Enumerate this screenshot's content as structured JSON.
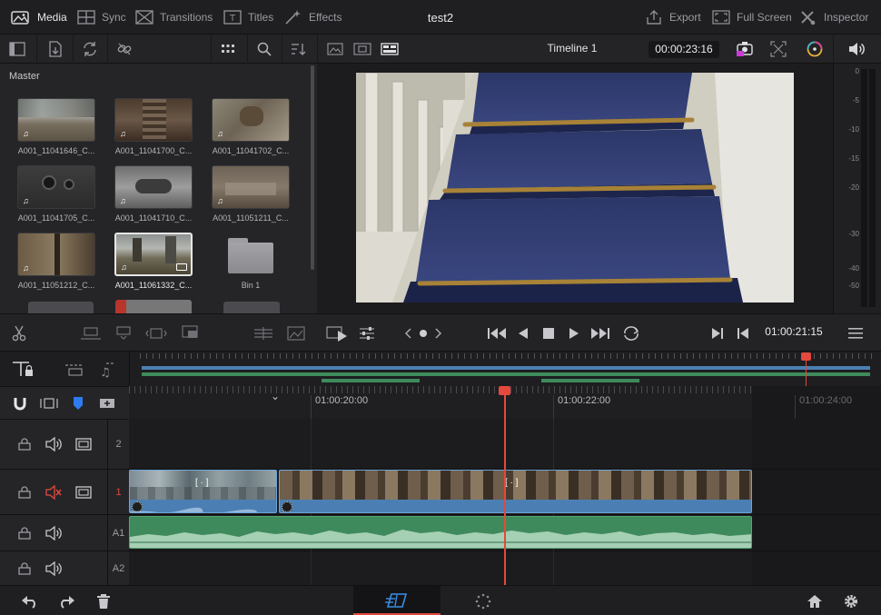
{
  "topbar": {
    "media": "Media",
    "sync": "Sync",
    "transitions": "Transitions",
    "titles": "Titles",
    "effects": "Effects",
    "project_title": "test2",
    "export": "Export",
    "full_screen": "Full Screen",
    "inspector": "Inspector"
  },
  "viewer": {
    "timeline_name": "Timeline 1",
    "source_timecode": "00:00:23:16"
  },
  "mediapool": {
    "bin_label": "Master",
    "clips": [
      {
        "name": "A001_11041646_C..."
      },
      {
        "name": "A001_11041700_C..."
      },
      {
        "name": "A001_11041702_C..."
      },
      {
        "name": "A001_11041705_C..."
      },
      {
        "name": "A001_11041710_C..."
      },
      {
        "name": "A001_11051211_C..."
      },
      {
        "name": "A001_11051212_C..."
      },
      {
        "name": "A001_11061332_C..."
      },
      {
        "name": "Bin 1"
      }
    ]
  },
  "meter": {
    "ticks": [
      "0",
      "-5",
      "-10",
      "-15",
      "-20",
      "-30",
      "-40",
      "-50"
    ]
  },
  "transport": {
    "timecode": "01:00:21:15"
  },
  "timeline": {
    "ruler_labels": [
      "01:00:20:00",
      "01:00:22:00",
      "01:00:24:00"
    ],
    "tracks": [
      {
        "label": "2"
      },
      {
        "label": "1"
      },
      {
        "label": "A1"
      },
      {
        "label": "A2"
      }
    ],
    "clip_marker": "[ · ]"
  },
  "colors": {
    "playhead": "#e5483d",
    "video_clip": "#4b7fb3",
    "audio_clip": "#3f8a5c",
    "active_tab_underline": "#e5483d"
  },
  "icons": [
    "media-icon",
    "sync-icon",
    "transitions-icon",
    "titles-icon",
    "effects-icon",
    "export-icon",
    "full-screen-icon",
    "inspector-icon",
    "search-icon",
    "scissors-icon",
    "play-icon",
    "stop-icon",
    "home-icon",
    "gear-icon",
    "undo-icon",
    "redo-icon",
    "trash-icon",
    "magnet-icon",
    "lock-icon",
    "speaker-icon",
    "mute-icon",
    "film-icon"
  ]
}
